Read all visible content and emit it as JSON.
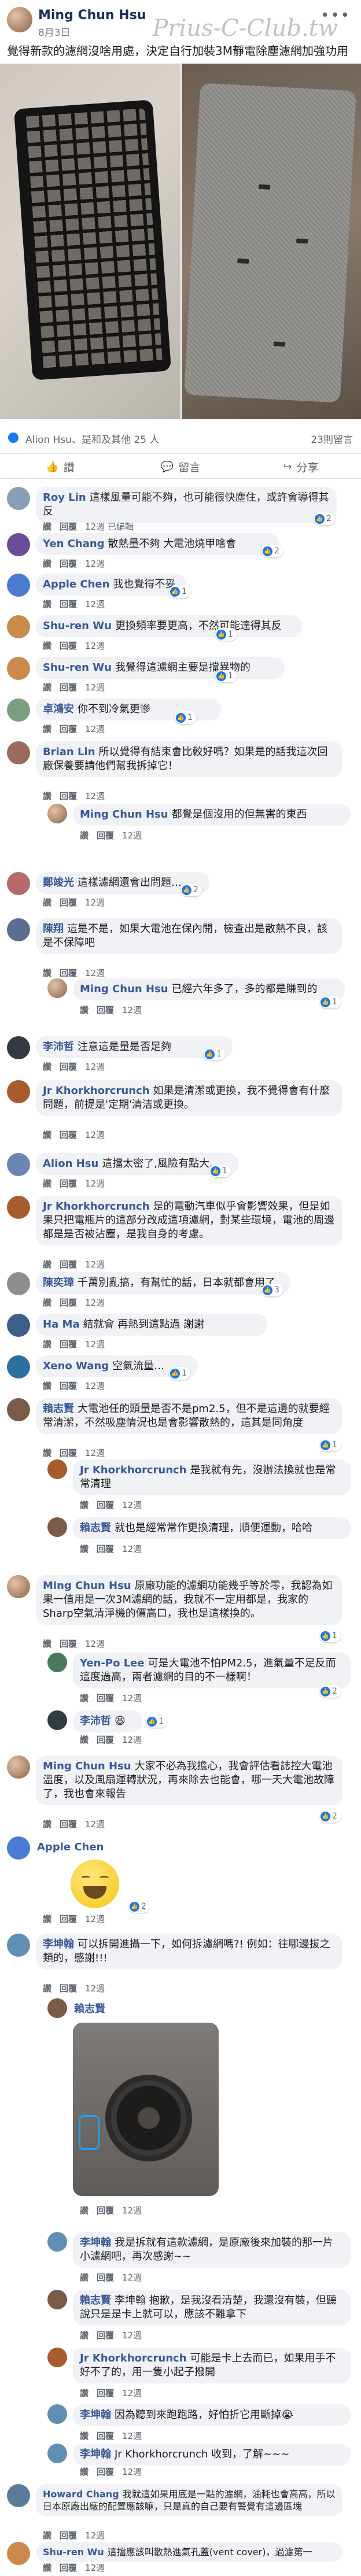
{
  "post": {
    "author": "Ming Chun Hsu",
    "date": "8月3日",
    "more": "•••",
    "watermark": "Prius-C-Club.tw",
    "text": "覺得新款的濾網沒啥用處，決定自行加裝3M靜電除塵濾網加強功用"
  },
  "reactions": {
    "text": "Alion Hsu、是和及其他 25 人",
    "comments_count": "23則留言"
  },
  "actions": {
    "like": "讚",
    "comment": "留言",
    "share": "分享"
  },
  "comments": [
    {
      "id": "c1",
      "name": "Roy Lin",
      "text": "這樣風量可能不夠，也可能很快塵住，或許會導得其反",
      "time": "12週",
      "extra": "已編輯",
      "likes": "2"
    },
    {
      "id": "c2",
      "name": "Yen Chang",
      "text": "散熱量不夠 大電池燒甲啥會",
      "time": "12週",
      "likes": "2"
    },
    {
      "id": "c3",
      "name": "Apple Chen",
      "text": "我也覺得不妥",
      "time": "12週",
      "likes": "1"
    },
    {
      "id": "c4",
      "name": "Shu-ren Wu",
      "text": "更換頻率要更高，不然可能達得其反",
      "time": "12週",
      "likes": "1"
    },
    {
      "id": "c5",
      "name": "Shu-ren Wu",
      "text": "我覺得這濾網主要是擋異物的",
      "time": "12週",
      "likes": "1"
    },
    {
      "id": "c6",
      "name": "卓鴻安",
      "text": "你不到冷氣更慘",
      "time": "12週",
      "likes": "1"
    },
    {
      "id": "c7",
      "name": "Brian Lin",
      "text": "所以覺得有結束會比較好嗎？如果是的話我這次回廠保養要請他們幫我拆掉它！",
      "time": "12週"
    },
    {
      "id": "c7r1",
      "name": "Ming Chun Hsu",
      "text": "都覺是個沒用的但無害的東西",
      "time": "12週"
    },
    {
      "id": "c8",
      "name": "鄭竣光",
      "text": "這樣濾網還會出問題…",
      "time": "12週",
      "likes": "2"
    },
    {
      "id": "c9",
      "name": "陳翔",
      "text": "這是不是，如果大電池在保內開，檢查出是散熱不良，該是不保障吧",
      "time": "12週"
    },
    {
      "id": "c9r1",
      "name": "Ming Chun Hsu",
      "text": "已經六年多了，多的都是賺到的",
      "time": "12週",
      "likes": "1"
    },
    {
      "id": "c10",
      "name": "李沛哲",
      "text": "注意這是量是否足夠",
      "time": "12週",
      "likes": "1"
    },
    {
      "id": "c11",
      "name": "Jr Khorkhorcrunch",
      "text": "如果是清潔或更換，我不覺得會有什麼問題，前提是'定期'清洁或更換。",
      "time": "12週"
    },
    {
      "id": "c12",
      "name": "Alion Hsu",
      "text": "這擋太密了,風險有點大…",
      "time": "12週",
      "likes": "1"
    },
    {
      "id": "c13",
      "name": "Jr Khorkhorcrunch",
      "text": "是的電動汽車似乎會影響效果，但是如果只把電瓶片的這部分改成這項濾網，對某些環境，電池的周邊都是是否被沾塵，是我自身的考慮。",
      "time": "12週"
    },
    {
      "id": "c14",
      "name": "陳奕璋",
      "text": "千萬別亂搞，有幫忙的話，日本就都會用了",
      "time": "12週",
      "likes": "3"
    },
    {
      "id": "c15",
      "name": "Ha Ma",
      "text": "結就會 再熱到這點過 謝謝",
      "time": "12週"
    },
    {
      "id": "c16",
      "name": "Xeno Wang",
      "text": "空氣流量…",
      "time": "12週",
      "likes": "1"
    },
    {
      "id": "c17",
      "name": "賴志賢",
      "text": "大電池任的頭量是否不是pm2.5，但不是這邊的就要經常清潔，不然吸塵情況也是會影響散熱的，這其是同角度",
      "time": "12週",
      "likes": "1"
    },
    {
      "id": "c17r1",
      "name": "Jr Khorkhorcrunch",
      "text": "是我就有先，沒辦法換就也是常常清理",
      "time": "12週"
    },
    {
      "id": "c17r2",
      "name": "賴志賢",
      "text": "就也是經常常作更換清理，順便運動，哈哈",
      "time": "12週"
    },
    {
      "id": "c18",
      "name": "Ming Chun Hsu",
      "text": "原廠功能的濾網功能幾乎等於零，我認為如果一值用是一次3M濾網的話，我就不一定用都是，我家的Sharp空氣清淨機的價高口，我也是這樣換的。",
      "time": "12週",
      "likes": "1"
    },
    {
      "id": "c18r1",
      "name": "Yen-Po Lee",
      "text": "可是大電池不怕PM2.5，進氣量不足反而這度過高，兩者濾網的目的不一樣啊！",
      "time": "12週",
      "likes": "2"
    },
    {
      "id": "c18r2",
      "name": "李沛哲",
      "text": "",
      "time": "12週",
      "likes": "1"
    },
    {
      "id": "c19",
      "name": "Ming Chun Hsu",
      "text": "大家不必為我擔心，我會評估看誌控大電池溫度，以及風扇運轉狀況，再來除去也能會，哪一天大電池故障了，我也會來報告",
      "time": "12週",
      "likes": "2"
    },
    {
      "id": "c20",
      "name": "Apple Chen",
      "text": "",
      "time": "12週",
      "likes": "2"
    },
    {
      "id": "c21",
      "name": "李坤翰",
      "text": "可以拆開進攝一下，如何拆濾網嗎?! 例如：往哪邊拔之類的，感謝!!!",
      "time": "12週"
    },
    {
      "id": "c21r1",
      "name": "賴志賢",
      "text": "",
      "time": "12週"
    },
    {
      "id": "c21r2",
      "name": "李坤翰",
      "text": "我是拆就有這款濾網，是原廠後來加裝的那一片 小濾網吧，再次感謝~~",
      "time": "12週"
    },
    {
      "id": "c21r3",
      "name": "賴志賢",
      "text": "李坤翰 抱歉，是我沒看清楚，我還沒有裝，但聽說只是是卡上就可以，應該不難拿下",
      "time": "12週"
    },
    {
      "id": "c21r4",
      "name": "Jr Khorkhorcrunch",
      "text": "可能是卡上去而已，如果用手不好不了的，用一隻小起子撥開",
      "time": "12週"
    },
    {
      "id": "c21r5",
      "name": "李坤翰",
      "text": "因為聽到來跑跑路，好怕折它用斷掉😭",
      "time": "12週"
    },
    {
      "id": "c21r6",
      "name": "李坤翰",
      "text": "Jr Khorkhorcrunch 收到，了解~~~",
      "time": "12週"
    },
    {
      "id": "c22",
      "name": "Howard Chang",
      "text": "我就這如果用底是一點的濾網，油耗也會高高，所以日本原廠出廠的配置應該嘛，只是真的自己要有警覺有這邊區塊",
      "time": "12週"
    },
    {
      "id": "c23",
      "name": "Shu-ren Wu",
      "text": "這擋應該叫散熱進氣孔蓋(vent cover)，過濾第一",
      "time": "12週"
    }
  ],
  "ui": {
    "like_label": "讚",
    "reply_label": "回覆"
  }
}
